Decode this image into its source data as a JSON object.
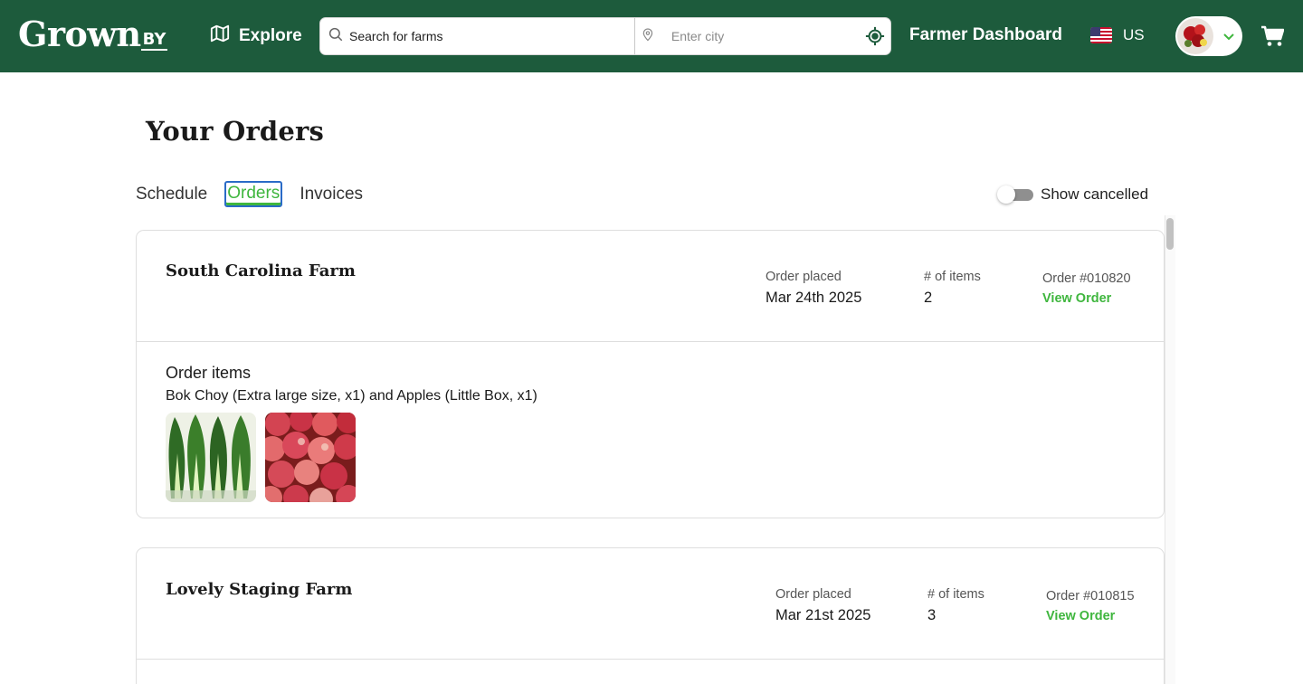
{
  "header": {
    "logo_main": "Grown",
    "logo_by": "BY",
    "explore_label": "Explore",
    "search_placeholder": "Search for farms",
    "city_placeholder": "Enter city",
    "dashboard_label": "Farmer Dashboard",
    "country_label": "US",
    "brand_color": "#1d5b3c",
    "icons": [
      "map-icon",
      "search-icon",
      "location-pin-icon",
      "locate-icon",
      "us-flag-icon",
      "chevron-down-icon",
      "cart-icon"
    ]
  },
  "page": {
    "title": "Your Orders",
    "tabs": [
      {
        "label": "Schedule",
        "active": false
      },
      {
        "label": "Orders",
        "active": true
      },
      {
        "label": "Invoices",
        "active": false
      }
    ],
    "show_cancelled_label": "Show cancelled",
    "show_cancelled_on": false,
    "accent_color": "#3fb63e"
  },
  "orders": [
    {
      "farm": "South Carolina Farm",
      "placed_label": "Order placed",
      "placed_date": "Mar 24th 2025",
      "items_label": "# of items",
      "items_count": "2",
      "order_number": "Order #010820",
      "view_label": "View Order",
      "items_title": "Order items",
      "items_desc": "Bok Choy (Extra large size, x1) and Apples (Little Box, x1)",
      "thumbnails": [
        "bok-choy-image",
        "apples-image"
      ]
    },
    {
      "farm": "Lovely Staging Farm",
      "placed_label": "Order placed",
      "placed_date": "Mar 21st 2025",
      "items_label": "# of items",
      "items_count": "3",
      "order_number": "Order #010815",
      "view_label": "View Order"
    }
  ]
}
